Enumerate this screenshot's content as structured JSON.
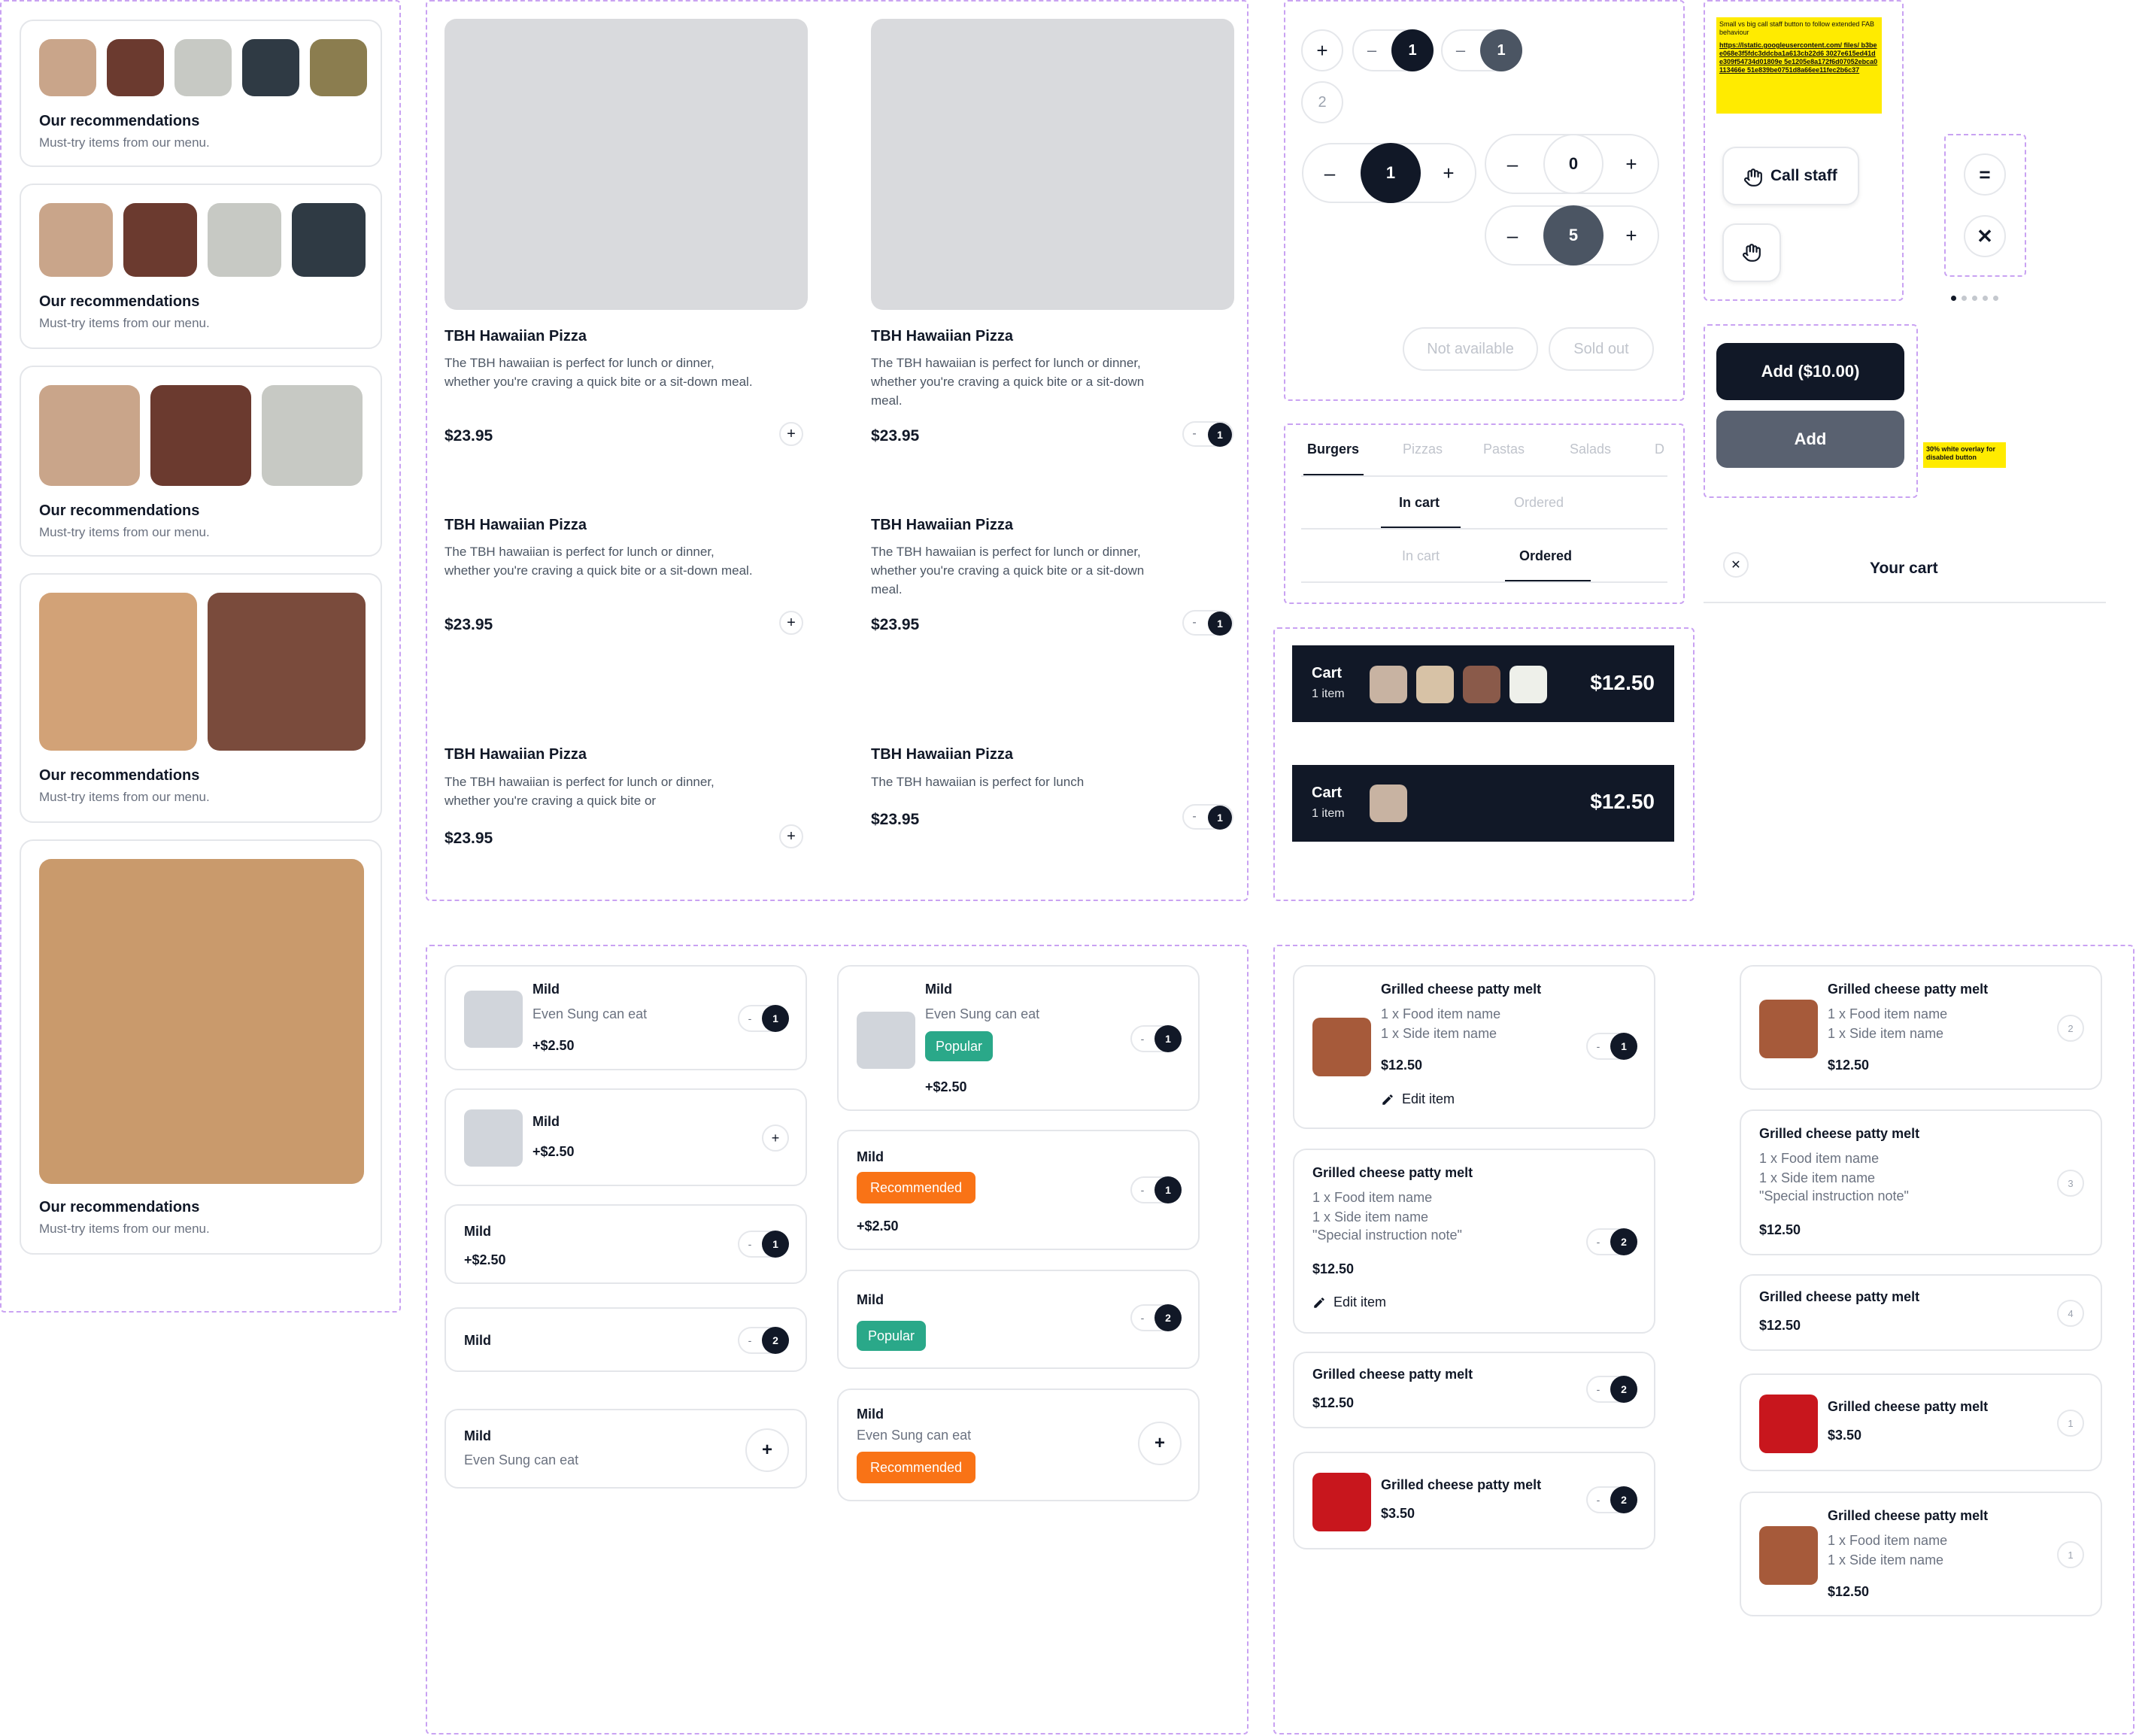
{
  "recs": {
    "title": "Our recommendations",
    "subtitle": "Must-try items from our menu."
  },
  "menu": {
    "item_title": "TBH Hawaiian Pizza",
    "desc_long": "The TBH hawaiian is perfect for lunch or dinner, whether you're craving a quick bite or a sit-down meal.",
    "desc_mid": "The TBH hawaiian is perfect for lunch or dinner, whether you're craving a quick bite or",
    "desc_short": "The TBH hawaiian is perfect for lunch",
    "price": "$23.95",
    "qty": "1"
  },
  "steppers": {
    "one": "1",
    "two": "2",
    "zero": "0",
    "five": "5",
    "not_available": "Not available",
    "sold_out": "Sold out"
  },
  "tabs": {
    "categories": [
      "Burgers",
      "Pizzas",
      "Pastas",
      "Salads",
      "D"
    ],
    "cart_tabs": [
      "In cart",
      "Ordered"
    ]
  },
  "cartbar": {
    "label": "Cart",
    "count": "1 item",
    "total": "$12.50"
  },
  "fab": {
    "note": "Small vs big call staff button to follow extended FAB behaviour",
    "link": "https://lstatic.googleusercontent.com/ files/ b3bee068e3f5fdc3ddcba1a613cb22d6 3027e615ed41de309f54734d01809e 5e1205e8a172f6d07052ebca0113466e 51e839be0751d8a66ee11fec2b6c37",
    "call_staff": "Call staff"
  },
  "addbtn": {
    "add_price": "Add ($10.00)",
    "add": "Add",
    "note": "30% white overlay for disabled button"
  },
  "cart_header": {
    "title": "Your cart"
  },
  "options": {
    "name": "Mild",
    "desc": "Even Sung can eat",
    "price": "+$2.50",
    "popular": "Popular",
    "recommended": "Recommended",
    "q1": "1",
    "q2": "2"
  },
  "cartitems": {
    "name": "Grilled cheese patty melt",
    "food": "1 x Food item name",
    "side": "1 x Side item name",
    "note": "\"Special instruction note\"",
    "price": "$12.50",
    "price2": "$3.50",
    "edit": "Edit item",
    "q1": "1",
    "q2": "2",
    "q3": "3",
    "q4": "4"
  },
  "colors": {
    "dark": "#111827",
    "popular": "#2aa889",
    "recommended": "#f97316",
    "accent_dashed": "#c9a2f2",
    "note_yellow": "#ffeb00"
  }
}
